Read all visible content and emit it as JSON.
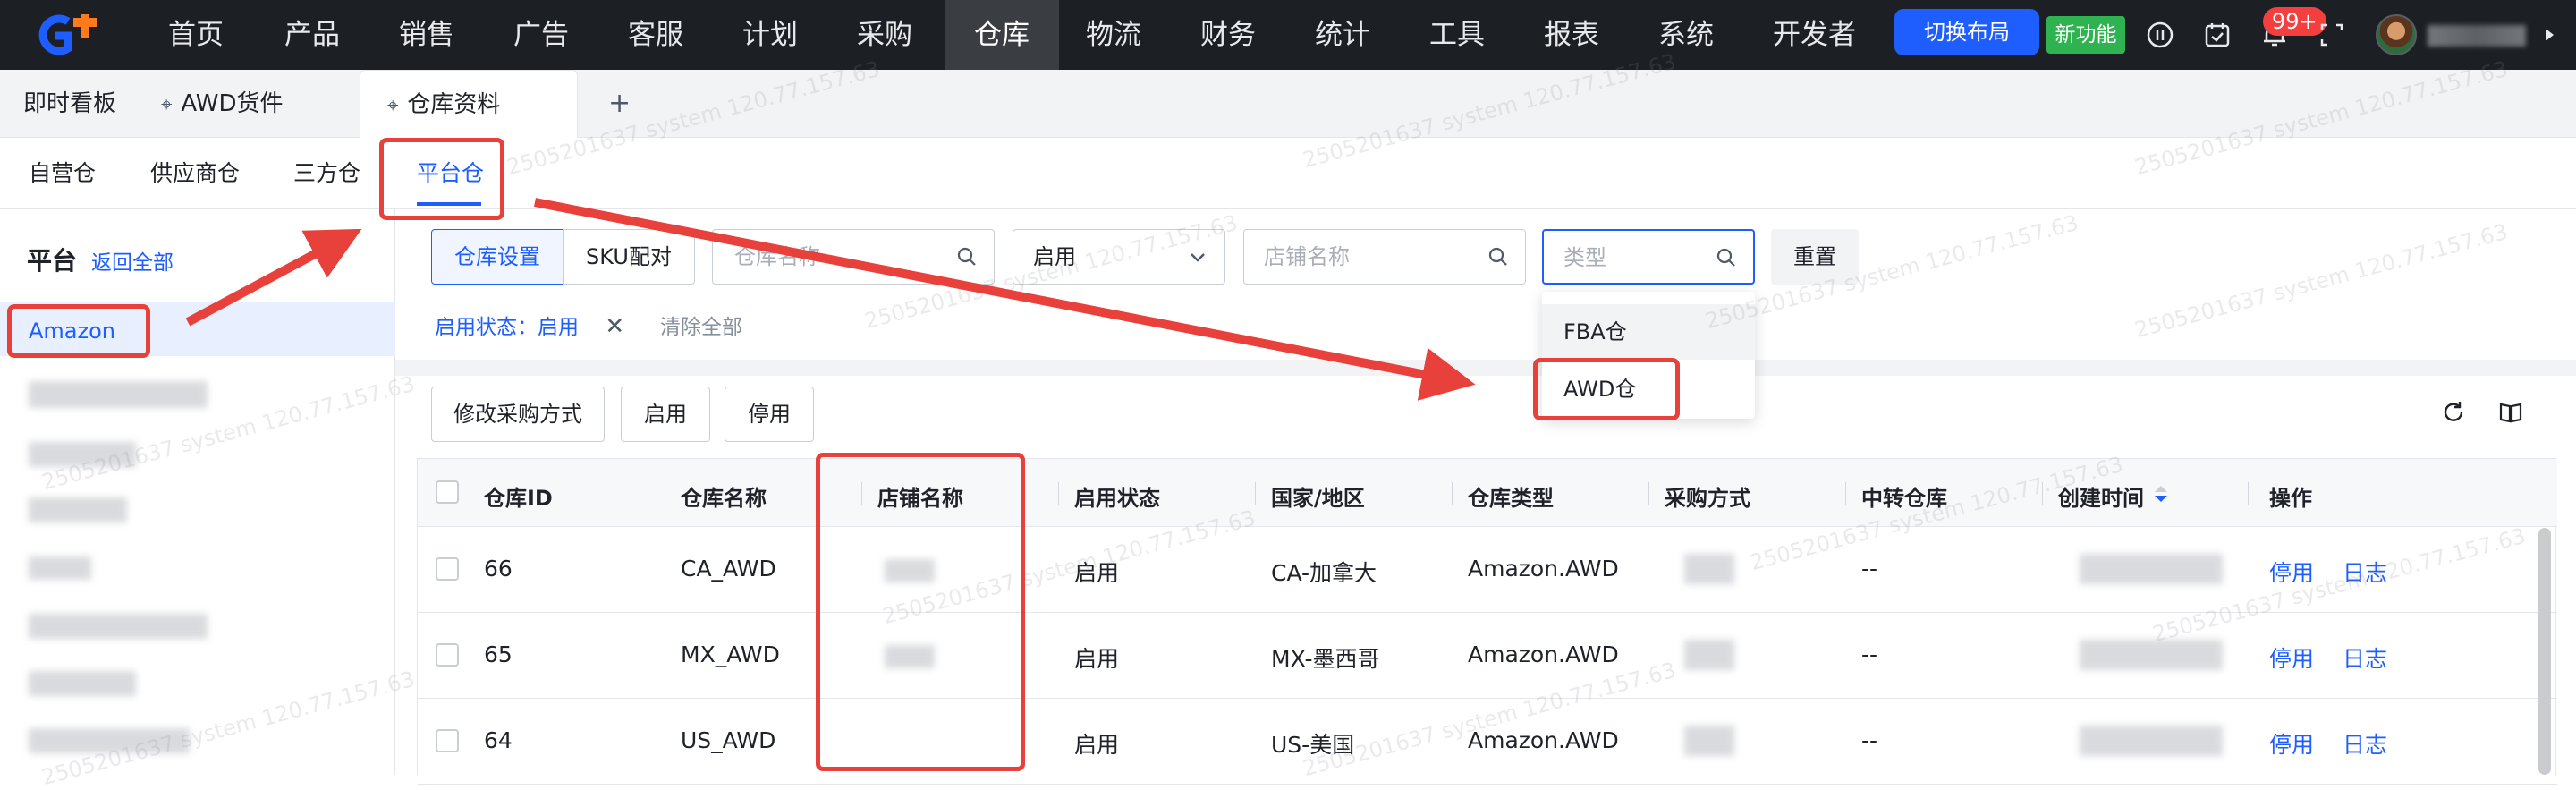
{
  "topnav": {
    "items": [
      "首页",
      "产品",
      "销售",
      "广告",
      "客服",
      "计划",
      "采购",
      "仓库",
      "物流",
      "财务",
      "统计",
      "工具",
      "报表",
      "系统",
      "开发者"
    ],
    "active_index": 7,
    "switch_layout": "切换布局",
    "new_feature": "新功能",
    "notification_count": "99+"
  },
  "page_tabs": [
    "即时看板",
    "AWD货件",
    "仓库资料"
  ],
  "sub_tabs": [
    "自营仓",
    "供应商仓",
    "三方仓",
    "平台仓"
  ],
  "sidebar": {
    "title": "平台",
    "back": "返回全部",
    "selected": "Amazon"
  },
  "filters": {
    "seg_warehouse": "仓库设置",
    "seg_sku": "SKU配对",
    "warehouse_name_ph": "仓库名称",
    "status_value": "启用",
    "store_name_ph": "店铺名称",
    "type_ph": "类型",
    "reset": "重置",
    "tag": "启用状态：启用",
    "clear_all": "清除全部"
  },
  "dropdown": [
    "FBA仓",
    "AWD仓"
  ],
  "actions": {
    "modify": "修改采购方式",
    "enable": "启用",
    "disable": "停用"
  },
  "table": {
    "headers": [
      "仓库ID",
      "仓库名称",
      "店铺名称",
      "启用状态",
      "国家/地区",
      "仓库类型",
      "采购方式",
      "中转仓库",
      "创建时间",
      "操作"
    ],
    "rows": [
      {
        "id": "66",
        "name": "CA_AWD",
        "status": "启用",
        "country": "CA-加拿大",
        "type": "Amazon.AWD",
        "transit": "--",
        "op1": "停用",
        "op2": "日志"
      },
      {
        "id": "65",
        "name": "MX_AWD",
        "status": "启用",
        "country": "MX-墨西哥",
        "type": "Amazon.AWD",
        "transit": "--",
        "op1": "停用",
        "op2": "日志"
      },
      {
        "id": "64",
        "name": "US_AWD",
        "status": "启用",
        "country": "US-美国",
        "type": "Amazon.AWD",
        "transit": "--",
        "op1": "停用",
        "op2": "日志"
      }
    ]
  },
  "watermark": "2505201637 system 120.77.157.63",
  "colors": {
    "primary": "#1e5eff",
    "annotation": "#e8403b",
    "nav_bg": "#1c1f23"
  }
}
